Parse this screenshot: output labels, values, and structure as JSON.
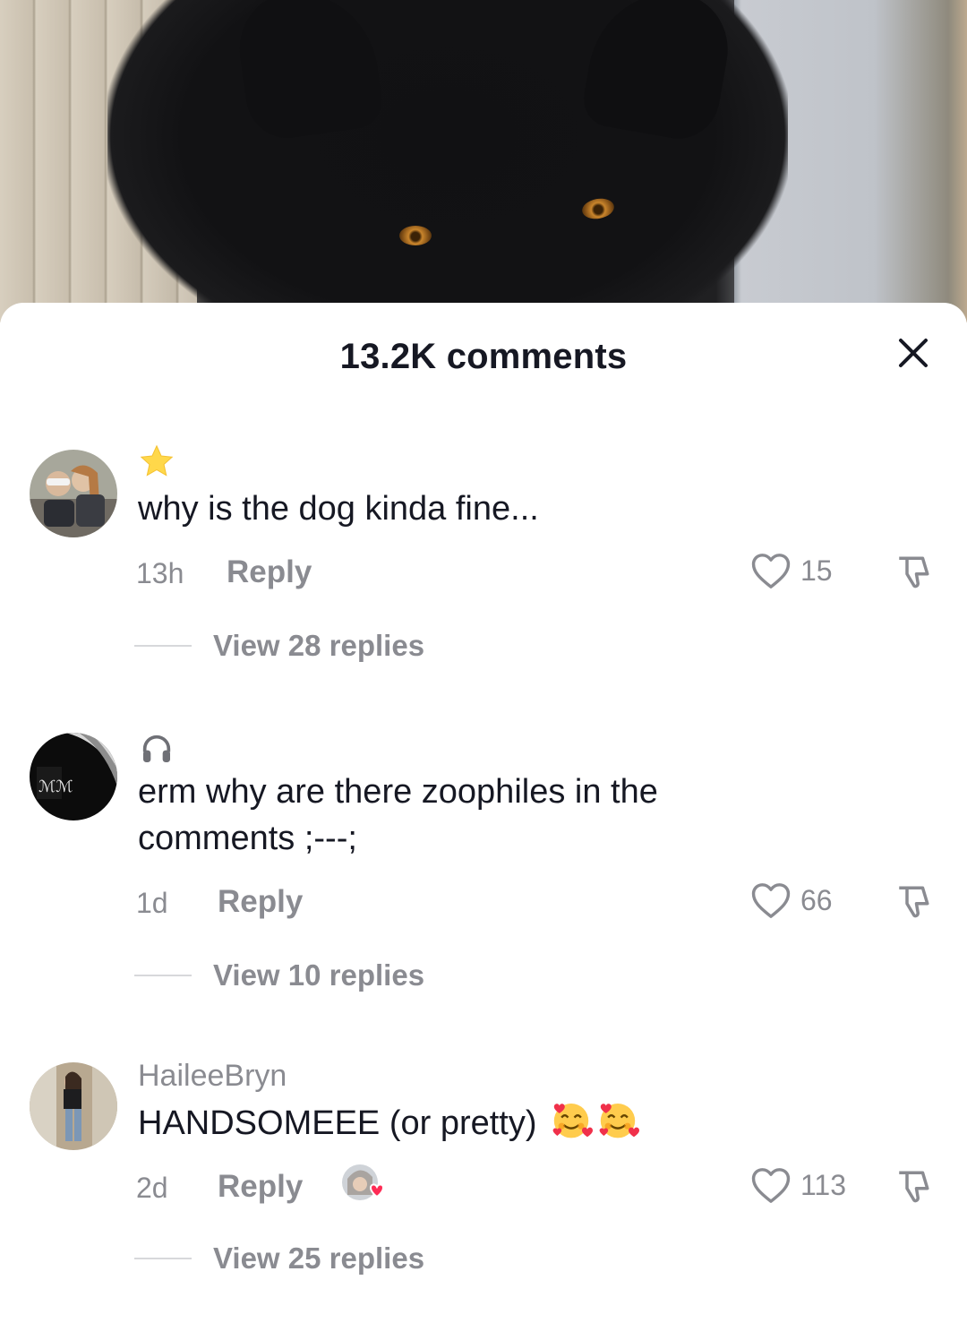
{
  "header": {
    "comment_count_label": "13.2K comments",
    "close_icon": "close-icon"
  },
  "comments": [
    {
      "badge": "star-icon",
      "username": "",
      "text": "why is the dog kinda fine...",
      "time": "13h",
      "reply_label": "Reply",
      "likes": "15",
      "view_replies": "View 28 replies"
    },
    {
      "badge": "headphones-icon",
      "username": "",
      "text": "erm why are there zoophiles in the comments ;---;",
      "time": "1d",
      "reply_label": "Reply",
      "likes": "66",
      "view_replies": "View 10 replies"
    },
    {
      "badge": "",
      "username": "HaileeBryn",
      "text": "HANDSOMEEE (or pretty)",
      "emojis": [
        "smiling-face-with-hearts-emoji",
        "smiling-face-with-hearts-emoji"
      ],
      "time": "2d",
      "reply_label": "Reply",
      "creator_liked": "creator-liked-heart-icon",
      "likes": "113",
      "view_replies": "View 25 replies"
    }
  ],
  "colors": {
    "primary_text": "#161823",
    "secondary_text": "#8a8b91",
    "heart_red": "#fe2c55"
  }
}
